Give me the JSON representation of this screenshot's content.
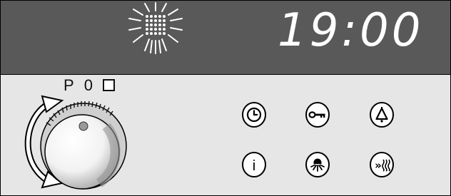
{
  "display": {
    "time": "19:00",
    "indicator_icon": "sun-burst-icon"
  },
  "selector": {
    "markings": [
      "P",
      "0"
    ],
    "square_marking_icon": "square-icon",
    "knob_icon": "rotary-knob",
    "rotation_icon": "rotate-arrows-icon"
  },
  "buttons": [
    {
      "icon": "clock-icon"
    },
    {
      "icon": "key-icon"
    },
    {
      "icon": "bell-icon"
    },
    {
      "icon": "info-icon",
      "label": "i"
    },
    {
      "icon": "oven-light-icon"
    },
    {
      "icon": "rapid-heat-icon",
      "label": "»"
    }
  ],
  "colors": {
    "display_bg": "#595959",
    "panel_bg": "#e6e6e6",
    "display_text": "#ffffff"
  }
}
